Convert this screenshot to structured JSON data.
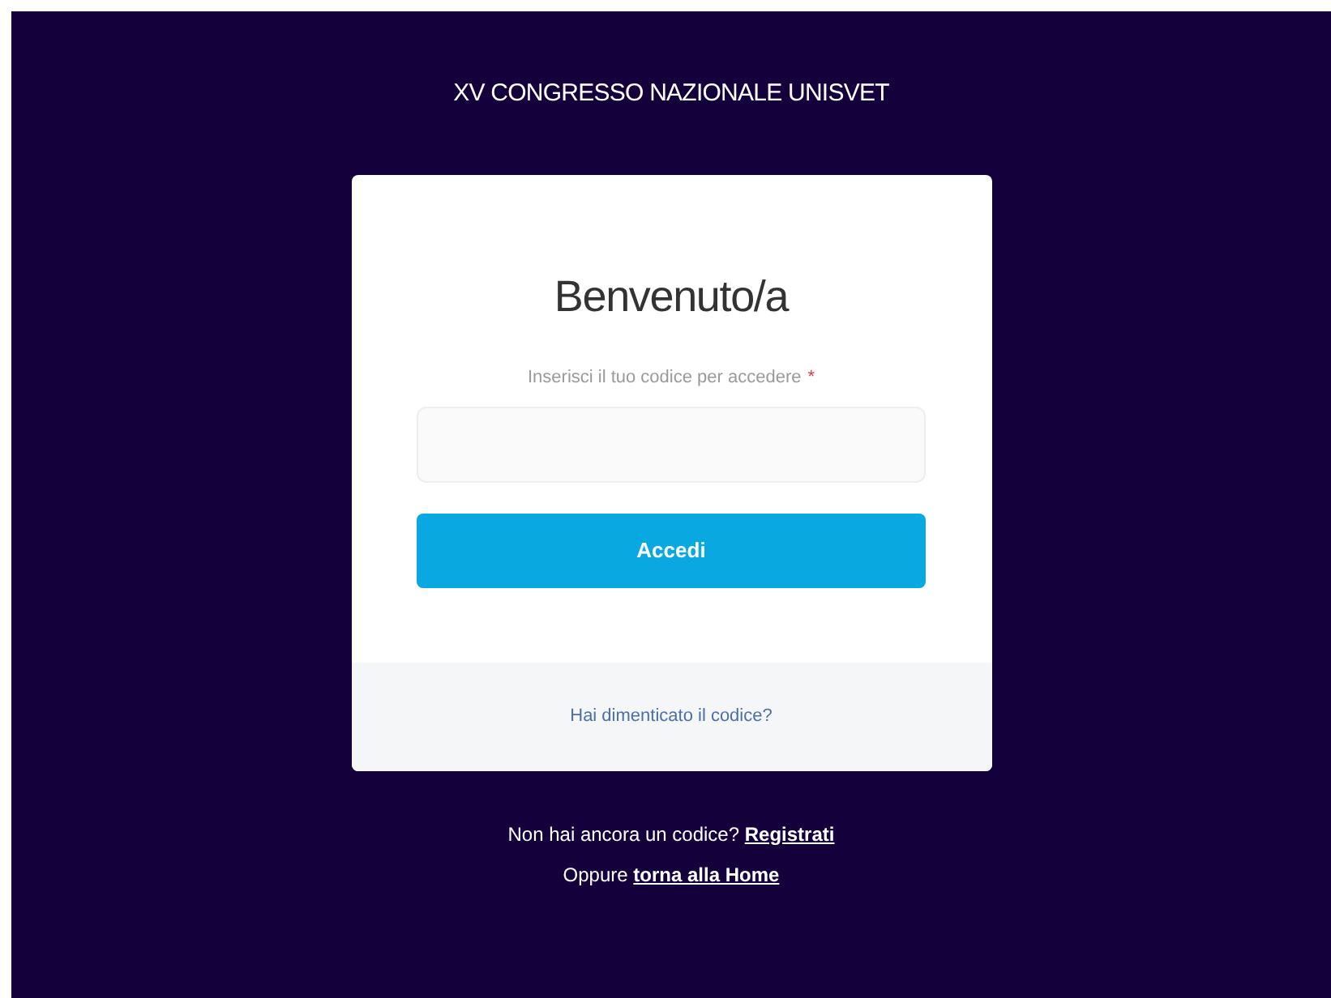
{
  "header": {
    "title": "XV CONGRESSO NAZIONALE UNISVET"
  },
  "card": {
    "heading": "Benvenuto/a",
    "field": {
      "label": "Inserisci il tuo codice per accedere",
      "required_mark": "*",
      "required": true
    },
    "button": "Accedi",
    "footer_link": "Hai dimenticato il codice?"
  },
  "bottom_lines": [
    {
      "text": "Non hai ancora un codice?",
      "link": "Registrati"
    },
    {
      "text": "Oppure",
      "link": "torna alla Home"
    }
  ]
}
